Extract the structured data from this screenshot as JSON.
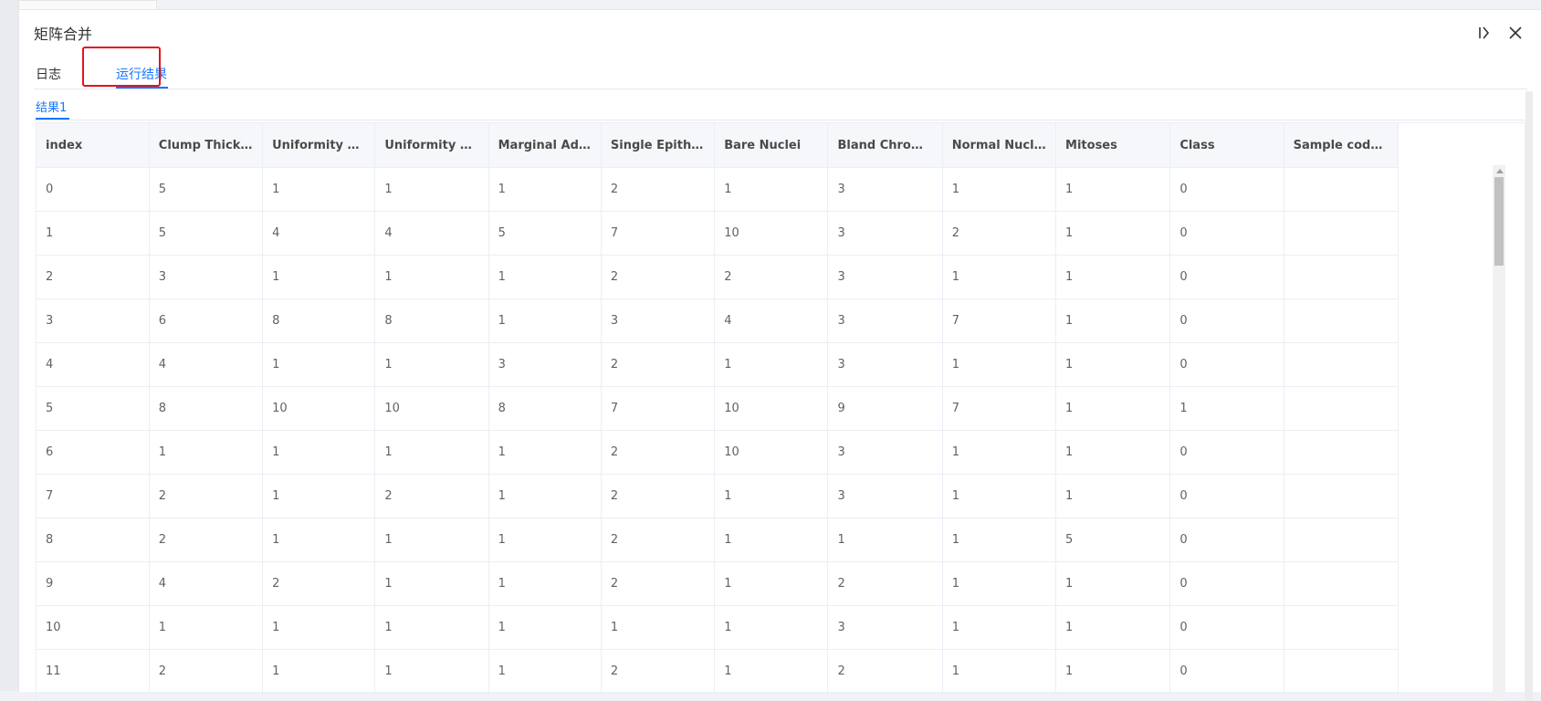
{
  "window": {
    "title": "矩阵合并"
  },
  "icons": {
    "panel_toggle": "panel-toggle-icon",
    "close": "close-icon"
  },
  "tabs": [
    {
      "label": "日志"
    },
    {
      "label": "运行结果"
    }
  ],
  "subtabs": [
    {
      "label": "结果1"
    }
  ],
  "table": {
    "columns": [
      "index",
      "Clump Thickness",
      "Uniformity of ...",
      "Uniformity of ...",
      "Marginal Adhe...",
      "Single Epitheli...",
      "Bare Nuclei",
      "Bland Chromatin",
      "Normal Nucleoli",
      "Mitoses",
      "Class",
      "Sample code n..."
    ],
    "rows": [
      [
        "0",
        "5",
        "1",
        "1",
        "1",
        "2",
        "1",
        "3",
        "1",
        "1",
        "0",
        ""
      ],
      [
        "1",
        "5",
        "4",
        "4",
        "5",
        "7",
        "10",
        "3",
        "2",
        "1",
        "0",
        ""
      ],
      [
        "2",
        "3",
        "1",
        "1",
        "1",
        "2",
        "2",
        "3",
        "1",
        "1",
        "0",
        ""
      ],
      [
        "3",
        "6",
        "8",
        "8",
        "1",
        "3",
        "4",
        "3",
        "7",
        "1",
        "0",
        ""
      ],
      [
        "4",
        "4",
        "1",
        "1",
        "3",
        "2",
        "1",
        "3",
        "1",
        "1",
        "0",
        ""
      ],
      [
        "5",
        "8",
        "10",
        "10",
        "8",
        "7",
        "10",
        "9",
        "7",
        "1",
        "1",
        ""
      ],
      [
        "6",
        "1",
        "1",
        "1",
        "1",
        "2",
        "10",
        "3",
        "1",
        "1",
        "0",
        ""
      ],
      [
        "7",
        "2",
        "1",
        "2",
        "1",
        "2",
        "1",
        "3",
        "1",
        "1",
        "0",
        ""
      ],
      [
        "8",
        "2",
        "1",
        "1",
        "1",
        "2",
        "1",
        "1",
        "1",
        "5",
        "0",
        ""
      ],
      [
        "9",
        "4",
        "2",
        "1",
        "1",
        "2",
        "1",
        "2",
        "1",
        "1",
        "0",
        ""
      ],
      [
        "10",
        "1",
        "1",
        "1",
        "1",
        "1",
        "1",
        "3",
        "1",
        "1",
        "0",
        ""
      ],
      [
        "11",
        "2",
        "1",
        "1",
        "1",
        "2",
        "1",
        "2",
        "1",
        "1",
        "0",
        ""
      ]
    ]
  },
  "colors": {
    "accent": "#1677ff",
    "highlight": "#e0141e"
  }
}
